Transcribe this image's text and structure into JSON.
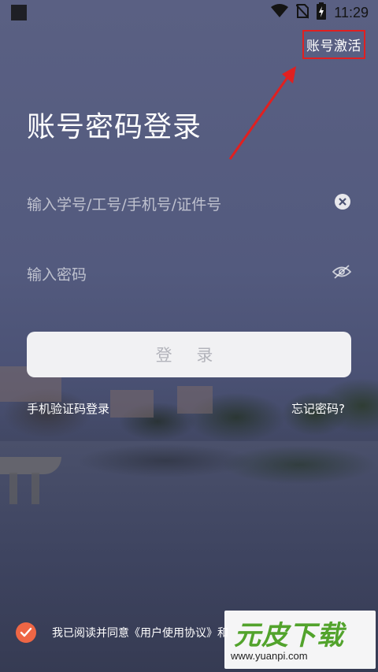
{
  "status_bar": {
    "time": "11:29",
    "icons": [
      "wifi-icon",
      "no-sim-icon",
      "battery-charging-icon"
    ]
  },
  "header": {
    "activate_link": "账号激活"
  },
  "login": {
    "title": "账号密码登录",
    "account_placeholder": "输入学号/工号/手机号/证件号",
    "password_placeholder": "输入密码",
    "login_button": "登 录",
    "sms_login_link": "手机验证码登录",
    "forgot_password_link": "忘记密码?"
  },
  "agreement": {
    "checked": true,
    "prefix": "我已阅读并同意",
    "protocol": "《用户使用协议》",
    "suffix": "和"
  },
  "watermark": {
    "logo_text": "元皮下载",
    "url": "www.yuanpi.com"
  },
  "colors": {
    "accent_red": "#e02020",
    "checkbox_orange": "#ee6645",
    "watermark_green": "#52a32c"
  }
}
